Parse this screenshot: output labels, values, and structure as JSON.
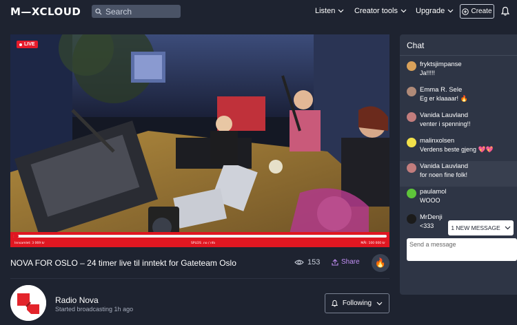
{
  "header": {
    "logo": "M—XCLOUD",
    "search_placeholder": "Search",
    "nav": [
      {
        "label": "Listen"
      },
      {
        "label": "Creator tools"
      },
      {
        "label": "Upgrade"
      }
    ],
    "create_label": "Create"
  },
  "video": {
    "live_label": "LIVE",
    "progress_fraction": 0.015,
    "progress_left": "Innsamlet: 3 069 kr",
    "progress_center": "SPLEIS .no / nfo",
    "progress_right": "MÅl: 100 000 kr"
  },
  "stream": {
    "title": "NOVA FOR OSLO – 24 timer live til inntekt for Gateteam Oslo",
    "views": "153",
    "share_label": "Share",
    "fire_icon": "🔥"
  },
  "channel": {
    "name": "Radio Nova",
    "subtitle": "Started broadcasting 1h ago",
    "following_label": "Following"
  },
  "chat": {
    "title": "Chat",
    "messages": [
      {
        "user": "fryktsjimpanse",
        "text": "Ja!!!!!",
        "avatar_color": "#d9a15a"
      },
      {
        "user": "Emma R. Sele",
        "text": "Eg er klaaaar! 🔥",
        "avatar_color": "#b08a78"
      },
      {
        "user": "Vanida Lauvland",
        "text": "venter i spenning!!",
        "avatar_color": "#c27d7d"
      },
      {
        "user": "malinxolsen",
        "text": "Verdens beste gjeng 💖💖",
        "avatar_color": "#f2e14a"
      },
      {
        "user": "Vanida Lauvland",
        "text": "for noen fine folk!",
        "avatar_color": "#c27d7d"
      },
      {
        "user": "paulamol",
        "text": "WOOO",
        "avatar_color": "#5ec43a"
      },
      {
        "user": "MrDenji",
        "text": "<333",
        "avatar_color": "#1b1b1b"
      }
    ],
    "new_message_label": "1 NEW MESSAGE",
    "send_placeholder": "Send a message"
  },
  "colors": {
    "background": "#1e2330",
    "panel": "#2e3545",
    "live_red": "#e61b2b",
    "share_purple": "#c28ff5"
  }
}
